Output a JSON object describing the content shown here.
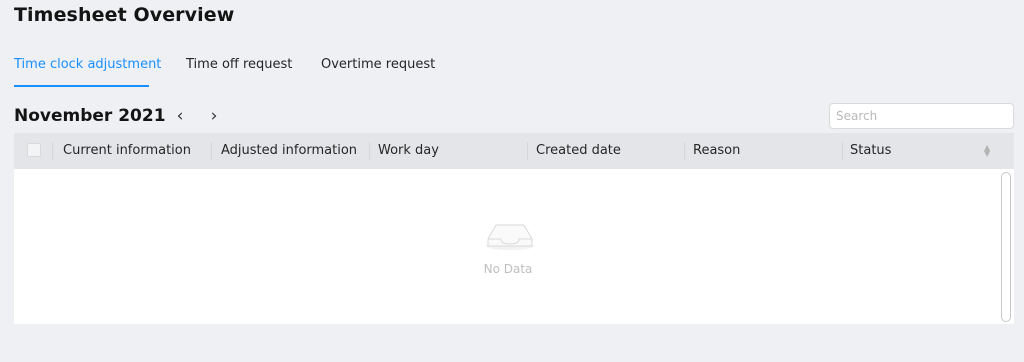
{
  "page": {
    "title": "Timesheet Overview"
  },
  "tabs": [
    {
      "label": "Time clock adjustment",
      "active": true
    },
    {
      "label": "Time off request",
      "active": false
    },
    {
      "label": "Overtime request",
      "active": false
    }
  ],
  "toolbar": {
    "month_label": "November 2021",
    "prev_icon": "chevron-left",
    "next_icon": "chevron-right",
    "prev_glyph": "‹",
    "next_glyph": "›"
  },
  "search": {
    "placeholder": "Search",
    "value": ""
  },
  "table": {
    "columns": [
      "Current information",
      "Adjusted information",
      "Work day",
      "Created date",
      "Reason",
      "Status"
    ],
    "rows": [],
    "empty_text": "No Data"
  },
  "colors": {
    "accent": "#1890ff",
    "page_bg": "#eef0f3",
    "header_bg": "#e3e5e8"
  }
}
